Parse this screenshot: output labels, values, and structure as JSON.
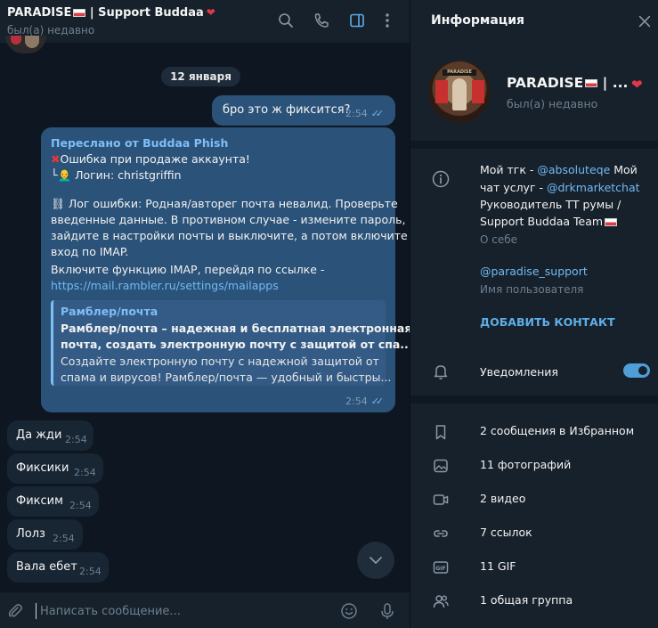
{
  "chat": {
    "title": "PARADISE",
    "title_suffix": " | Support Buddaa",
    "status": "был(а) недавно",
    "date_separator": "12 января",
    "outgoing": {
      "text": "бро это ж фиксится?",
      "time": "2:54"
    },
    "forwarded": {
      "from": "Переслано от Buddaa Phish",
      "line1": "Ошибка при продаже аккаунта!",
      "line2": "└👨‍🦲 Логин: christgriffin",
      "line3": "⛓ Лог ошибки: Родная/авторег почта невалид. Проверьте",
      "line4": "введенные данные. В противном случае - измените пароль,",
      "line5": "зайдите в настройки почты и выключите, а потом включите",
      "line6": "вход по IMAP.",
      "line7": "Включите функцию IMAP, перейдя по ссылке -",
      "link": "https://mail.rambler.ru/settings/mailapps",
      "preview_site": "Рамблер/почта",
      "preview_title1": "Рамблер/почта – надежная и бесплатная электронная",
      "preview_title2": "почта, создать электронную почту с защитой от спа...",
      "preview_desc1": "Создайте электронную почту с надежной защитой от",
      "preview_desc2": "спама и вирусов! Рамблер/почта — удобный и быстры...",
      "time": "2:54"
    },
    "incoming": [
      {
        "text": "Да жди",
        "time": "2:54"
      },
      {
        "text": "Фиксики",
        "time": "2:54"
      },
      {
        "text": "Фиксим",
        "time": "2:54"
      },
      {
        "text": "Лолз",
        "time": "2:54"
      },
      {
        "text": "Вала ебет",
        "time": "2:54"
      }
    ],
    "composer_placeholder": "Написать сообщение..."
  },
  "info": {
    "header": "Информация",
    "name": "PARADISE",
    "name_suffix": " | ...",
    "status": "был(а) недавно",
    "avatar_text": "PARADISE",
    "bio": {
      "l1_prefix": "Мой тгк - ",
      "l1_mention": "@absoluteqe",
      "l1_suffix": " Мой",
      "l2_prefix": "чат услуг - ",
      "l2_mention": "@drkmarketchat",
      "l3": "Руководитель ТТ румы /",
      "l4": "Support Buddaa Team"
    },
    "bio_label": "О себе",
    "username": "@paradise_support",
    "username_label": "Имя пользователя",
    "add_contact": "ДОБАВИТЬ КОНТАКТ",
    "notifications": "Уведомления",
    "notifications_on": true,
    "media": [
      {
        "icon": "bookmark-icon",
        "label": "2 сообщения в Избранном"
      },
      {
        "icon": "photo-icon",
        "label": "11 фотографий"
      },
      {
        "icon": "video-icon",
        "label": "2 видео"
      },
      {
        "icon": "link-icon",
        "label": "7 ссылок"
      },
      {
        "icon": "gif-icon",
        "label": "11 GIF"
      },
      {
        "icon": "group-icon",
        "label": "1 общая группа"
      }
    ]
  },
  "colors": {
    "chat_bg": "#0e1621",
    "panel_bg": "#17212b",
    "outgoing_bubble": "#2b5278",
    "incoming_bubble": "#182533",
    "accent": "#71baf5"
  }
}
